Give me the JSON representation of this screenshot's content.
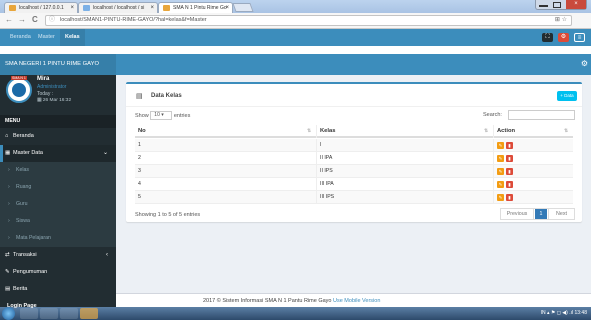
{
  "browser": {
    "tabs": [
      {
        "label": "localhost / 127.0.0.1"
      },
      {
        "label": "localhost / localhost / si"
      },
      {
        "label": "SMA N 1 Pintu Rime Go"
      }
    ],
    "close_glyph": "×",
    "back_glyph": "←",
    "forward_glyph": "→",
    "reload_glyph": "C",
    "info_glyph": "ⓘ",
    "address": "localhost/SMAN1-PINTU-RIME-GAYO/?hal=kelas&f=Master",
    "address_icons": "⊞ ☆",
    "colors": {
      "tab1": "#e8a63c",
      "tab2": "#7bb0e6",
      "tab3": "#e8a63c"
    }
  },
  "topnav": {
    "links": [
      "Beranda",
      "Master",
      "Kelas"
    ],
    "buttons": [
      "⛶",
      "⚙",
      "≡"
    ],
    "button_colors": [
      "#222d32",
      "#dd4b39",
      "#3c8dbc"
    ]
  },
  "app": {
    "title": "SMA NEGERI 1 PINTU RIME GAYO",
    "gear": "⚙"
  },
  "user": {
    "badge": "SMA N 1",
    "name": "Mira",
    "role": "Administrator",
    "today": "Today :",
    "date": "▦ 26 Mar 16:32"
  },
  "sidebar": {
    "header": "MENU",
    "items": [
      {
        "icon": "⌂",
        "label": "Beranda"
      },
      {
        "icon": "▦",
        "label": "Master Data",
        "chevron": "⌄"
      },
      {
        "icon": "›",
        "label": "Kelas"
      },
      {
        "icon": "›",
        "label": "Ruang"
      },
      {
        "icon": "›",
        "label": "Guru"
      },
      {
        "icon": "›",
        "label": "Siswa"
      },
      {
        "icon": "›",
        "label": "Mata Pelajaran"
      },
      {
        "icon": "⇄",
        "label": "Transaksi",
        "chevron": "‹"
      },
      {
        "icon": "✎",
        "label": "Pengumuman"
      },
      {
        "icon": "▤",
        "label": "Berita"
      }
    ],
    "logout": "Login Page"
  },
  "box": {
    "icon": "▤",
    "title": "Data Kelas",
    "add_label": "+ Data",
    "show_label": "Show",
    "entries_value": "10",
    "entries_label": "entries",
    "search_label": "Search:",
    "columns": [
      "No",
      "Kelas",
      "Action"
    ],
    "sort_glyphs": [
      "⇅",
      "⇅",
      "⇅"
    ],
    "edit_glyph": "✎",
    "delete_glyph": "▮",
    "rows": [
      {
        "no": "1",
        "kelas": "I"
      },
      {
        "no": "2",
        "kelas": "II IPA"
      },
      {
        "no": "3",
        "kelas": "II IPS"
      },
      {
        "no": "4",
        "kelas": "III IPA"
      },
      {
        "no": "5",
        "kelas": "III IPS"
      }
    ],
    "info": "Showing 1 to 5 of 5 entries",
    "pagination": {
      "prev": "Previous",
      "current": "1",
      "next": "Next"
    }
  },
  "footer": {
    "text": "2017 © Sistem Informasi SMA N 1 Pantu Rime Gayo",
    "version": "Use Mobile Version"
  },
  "taskbar": {
    "tray": "IN ▴ ⚑ ◻ ◀) .ıl   13:48"
  }
}
